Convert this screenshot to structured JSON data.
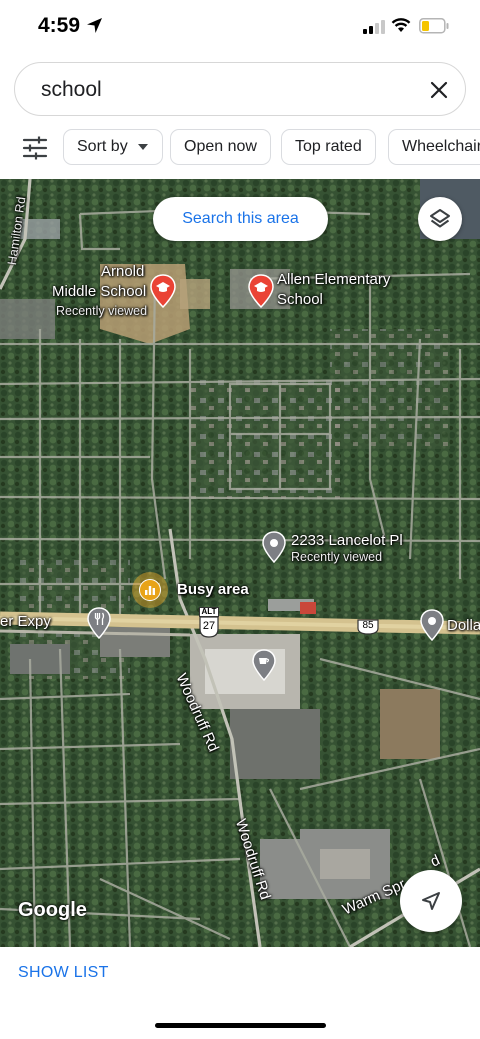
{
  "status_bar": {
    "time": "4:59"
  },
  "search": {
    "query": "school"
  },
  "filters": {
    "sort_by": "Sort by",
    "open_now": "Open now",
    "top_rated": "Top rated",
    "wheelchair": "Wheelchair"
  },
  "map": {
    "search_area_button": "Search this area",
    "attribution": "Google",
    "places": [
      {
        "name_line1": "Arnold",
        "name_line2": "Middle School",
        "note": "Recently viewed"
      },
      {
        "name_line1": "Allen Elementary",
        "name_line2": "School"
      },
      {
        "name_line1": "2233 Lancelot Pl",
        "note": "Recently viewed"
      }
    ],
    "busy_area": "Busy area",
    "roads": {
      "hamilton": "Hamilton Rd",
      "expy": "er Expy",
      "dollar": "Dolla",
      "woodruff1": "Woodruff Rd",
      "woodruff2": "Woodruff Rd",
      "warm_springs": "Warm Spr",
      "warm_springs_tail": "d"
    },
    "shields": {
      "us27": "27",
      "alt": "ALT",
      "i85": "85"
    }
  },
  "bottom": {
    "show_list": "SHOW LIST"
  }
}
